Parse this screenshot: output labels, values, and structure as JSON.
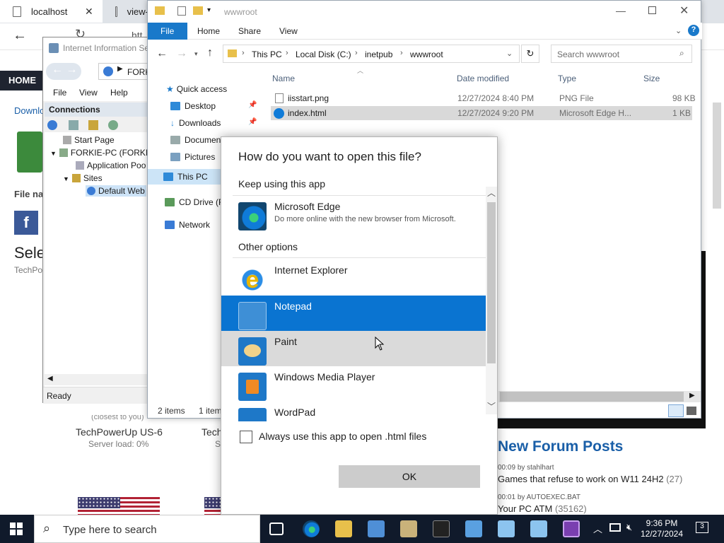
{
  "browser": {
    "tabs": [
      "localhost",
      "view-"
    ],
    "address_partial": "htt",
    "home_label": "HOME",
    "left_texts": {
      "download": "Downlo",
      "file_name": "File na",
      "select": "Sele",
      "techpo": "TechPo"
    },
    "server1": {
      "closest": "(closest to you)",
      "name": "TechPowerUp US-6",
      "load": "Server load: 0%"
    },
    "server2": {
      "name": "Tech",
      "load": "Se"
    },
    "forum": {
      "heading": "New Forum Posts",
      "posts": [
        {
          "time": "00:09",
          "by": "by",
          "user": "stahlhart",
          "title": "Games that refuse to work on W11 24H2",
          "count": "(27)"
        },
        {
          "time": "00:01",
          "by": "by",
          "user": "AUTOEXEC.BAT",
          "title": "Your PC ATM",
          "count": "(35162)"
        }
      ]
    }
  },
  "iis": {
    "title": "Internet Information Se",
    "address": "FORK",
    "menu": [
      "File",
      "View",
      "Help"
    ],
    "connections_label": "Connections",
    "tree": [
      "Start Page",
      "FORKIE-PC (FORKIE",
      "Application Poo",
      "Sites",
      "Default Web"
    ],
    "status": "Ready"
  },
  "explorer": {
    "quick_title": "wwwroot",
    "ribbon_tabs": [
      "File",
      "Home",
      "Share",
      "View"
    ],
    "breadcrumb": [
      "This PC",
      "Local Disk (C:)",
      "inetpub",
      "wwwroot"
    ],
    "search_placeholder": "Search wwwroot",
    "columns": [
      "Name",
      "Date modified",
      "Type",
      "Size"
    ],
    "files": [
      {
        "name": "iisstart.png",
        "date": "12/27/2024 8:40 PM",
        "type": "PNG File",
        "size": "98 KB"
      },
      {
        "name": "index.html",
        "date": "12/27/2024 9:20 PM",
        "type": "Microsoft Edge H...",
        "size": "1 KB"
      }
    ],
    "nav": {
      "quick_access": "Quick access",
      "items": [
        "Desktop",
        "Downloads",
        "Documen",
        "Pictures"
      ],
      "this_pc": "This PC",
      "cd_drive": "CD Drive (F",
      "network": "Network"
    },
    "status_items": "2 items",
    "status_sel": "1 item"
  },
  "dialog": {
    "title": "How do you want to open this file?",
    "keep_using": "Keep using this app",
    "default_app": {
      "name": "Microsoft Edge",
      "desc": "Do more online with the new browser from Microsoft."
    },
    "other_options": "Other options",
    "apps": [
      "Internet Explorer",
      "Notepad",
      "Paint",
      "Windows Media Player",
      "WordPad"
    ],
    "checkbox_label": "Always use this app to open .html files",
    "ok_label": "OK"
  },
  "taskbar": {
    "search_placeholder": "Type here to search",
    "time": "9:36 PM",
    "date": "12/27/2024",
    "notification_count": "3"
  },
  "colors": {
    "accent": "#0a74d1",
    "taskbar": "#101a2b",
    "file_tab": "#1979ca",
    "edge": "#0f7bd8",
    "forum_heading": "#1a5fa8"
  }
}
